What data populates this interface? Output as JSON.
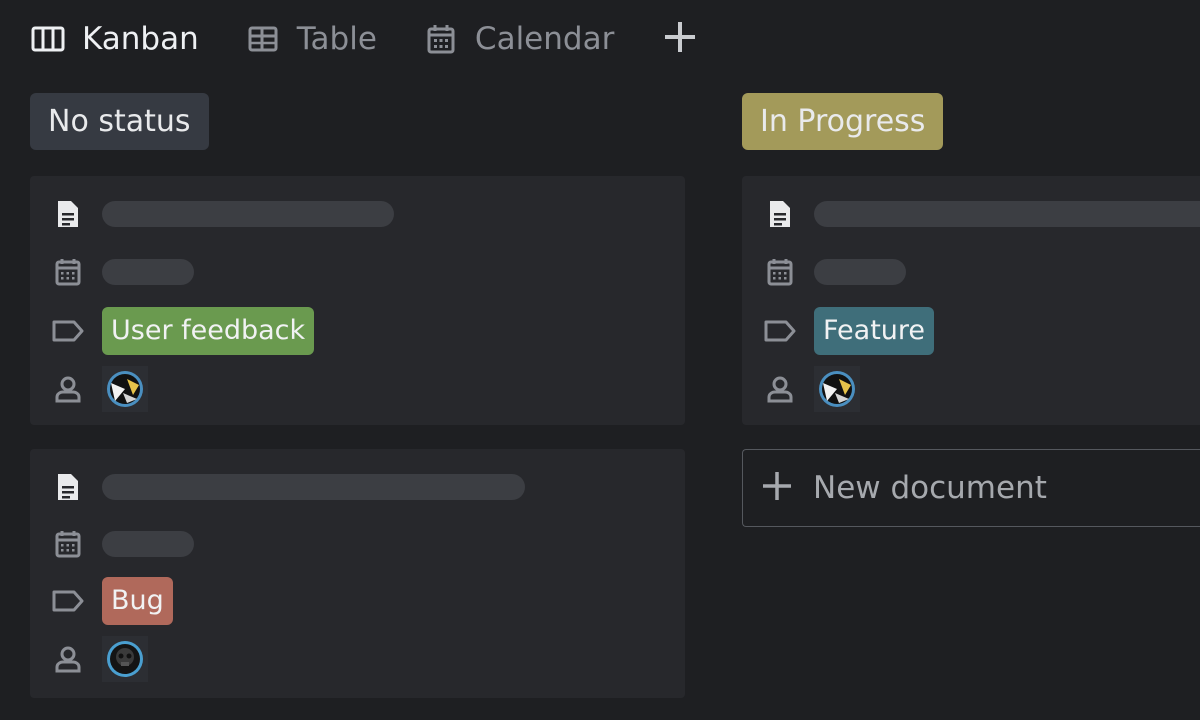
{
  "tabs": [
    {
      "label": "Kanban",
      "icon": "columns-icon",
      "active": true
    },
    {
      "label": "Table",
      "icon": "table-icon",
      "active": false
    },
    {
      "label": "Calendar",
      "icon": "calendar-icon",
      "active": false
    }
  ],
  "columns": [
    {
      "title": "No status",
      "header_color": "#363a42",
      "cards": [
        {
          "tag": "User feedback",
          "tag_color": "#6a9a4f",
          "assignee": "avatar"
        },
        {
          "tag": "Bug",
          "tag_color": "#b0695b",
          "assignee": "avatar"
        }
      ]
    },
    {
      "title": "In Progress",
      "header_color": "#a39a5a",
      "cards": [
        {
          "tag": "Feature",
          "tag_color": "#3f6e7a",
          "assignee": "avatar"
        }
      ],
      "new_document_label": "New document"
    }
  ],
  "colors": {
    "background": "#1e1f22",
    "card": "#27282c",
    "skeleton": "#3c3e43"
  }
}
